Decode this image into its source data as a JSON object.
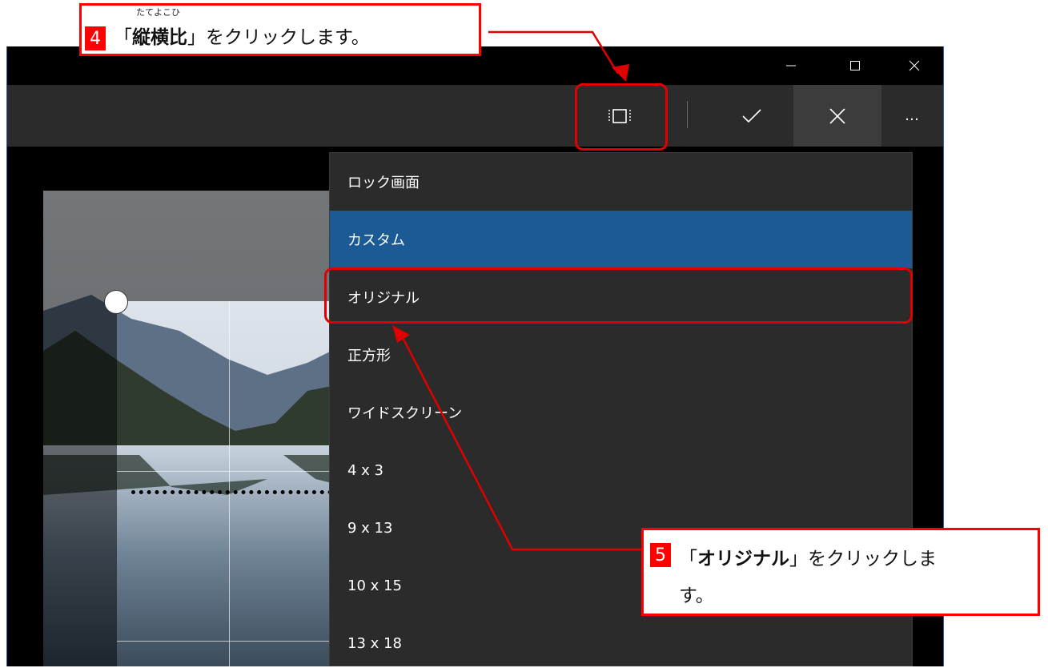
{
  "window": {
    "controls": {
      "minimize_icon": "minimize-icon",
      "maximize_icon": "maximize-icon",
      "close_icon": "close-icon"
    }
  },
  "toolbar": {
    "aspect_ratio_icon": "aspect-ratio-icon",
    "confirm_icon": "check-icon",
    "cancel_icon": "close-icon",
    "more_label": "…"
  },
  "menu": {
    "items": [
      {
        "label": "ロック画面",
        "selected": false
      },
      {
        "label": "カスタム",
        "selected": true
      },
      {
        "label": "オリジナル",
        "selected": false
      },
      {
        "label": "正方形",
        "selected": false
      },
      {
        "label": "ワイドスクリーン",
        "selected": false
      },
      {
        "label": "4 x 3",
        "selected": false
      },
      {
        "label": "9 x 13",
        "selected": false
      },
      {
        "label": "10 x 15",
        "selected": false
      },
      {
        "label": "13 x 18",
        "selected": false
      }
    ],
    "selected_color": "#1b5a94"
  },
  "callouts": {
    "step4": {
      "number": "4",
      "ruby": "たてよこひ",
      "quote_open": "「",
      "emph": "縦横比",
      "quote_close": "」",
      "text": "をクリックします。"
    },
    "step5": {
      "number": "5",
      "quote_open": "「",
      "emph": "オリジナル",
      "quote_close": "」",
      "text_line1": "をクリックしま",
      "text_line2": "す。"
    }
  },
  "accent_color": "#ff0000"
}
